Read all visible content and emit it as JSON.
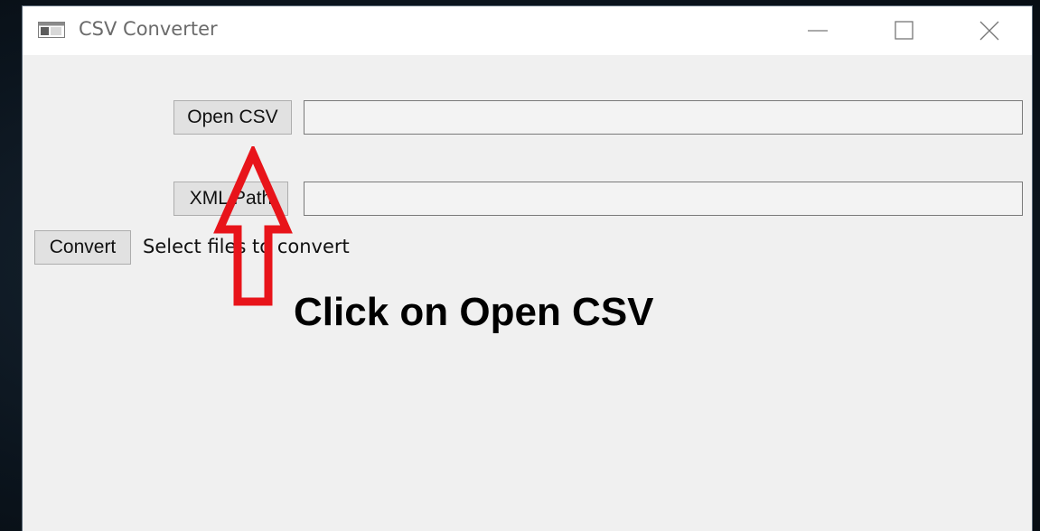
{
  "window": {
    "title": "CSV Converter"
  },
  "titlebar_icons": {
    "app": "app-window-icon",
    "minimize": "minimize-icon",
    "maximize": "maximize-icon",
    "close": "close-icon"
  },
  "form": {
    "open_csv_label": "Open CSV",
    "csv_path_value": "",
    "xml_path_label": "XML Path",
    "xml_path_value": "",
    "convert_label": "Convert",
    "status_text": "Select files to convert"
  },
  "annotation": {
    "instruction": "Click on Open CSV",
    "arrow_color": "#e8141a",
    "icon": "up-arrow-icon"
  }
}
